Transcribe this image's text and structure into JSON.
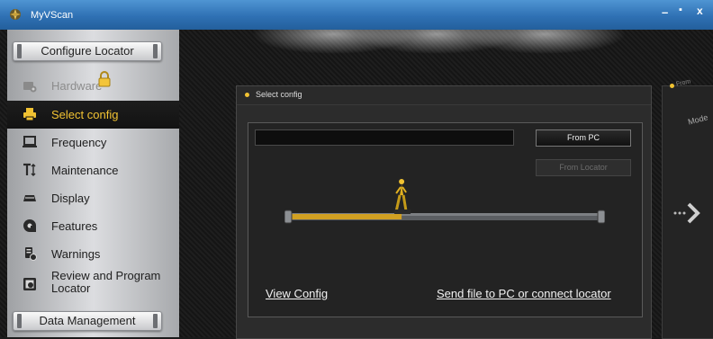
{
  "window": {
    "title": "MyVScan",
    "minimize": "–",
    "maximize": "▪",
    "close": "x"
  },
  "sidebar": {
    "configure_header": "Configure Locator",
    "data_header": "Data Management",
    "items": [
      {
        "label": "Hardware",
        "icon": "hardware-icon",
        "state": "disabled"
      },
      {
        "label": "Select config",
        "icon": "select-config-icon",
        "state": "active"
      },
      {
        "label": "Frequency",
        "icon": "frequency-icon",
        "state": "normal"
      },
      {
        "label": "Maintenance",
        "icon": "maintenance-icon",
        "state": "normal"
      },
      {
        "label": "Display",
        "icon": "display-icon",
        "state": "normal"
      },
      {
        "label": "Features",
        "icon": "features-icon",
        "state": "normal"
      },
      {
        "label": "Warnings",
        "icon": "warnings-icon",
        "state": "normal"
      },
      {
        "label_line1": "Review and Program",
        "label_line2": "Locator",
        "icon": "review-program-icon",
        "state": "normal"
      }
    ]
  },
  "panel": {
    "title": "Select config",
    "from_pc_label": "From PC",
    "from_locator_label": "From Locator",
    "progress_fraction": 0.36,
    "view_config_link": "View Config",
    "send_file_link": "Send file to PC or connect locator"
  },
  "right_panel": {
    "from_label": "From",
    "mode_label": "Mode"
  },
  "colors": {
    "accent": "#f1c232",
    "titlebar": "#2f71b4"
  }
}
